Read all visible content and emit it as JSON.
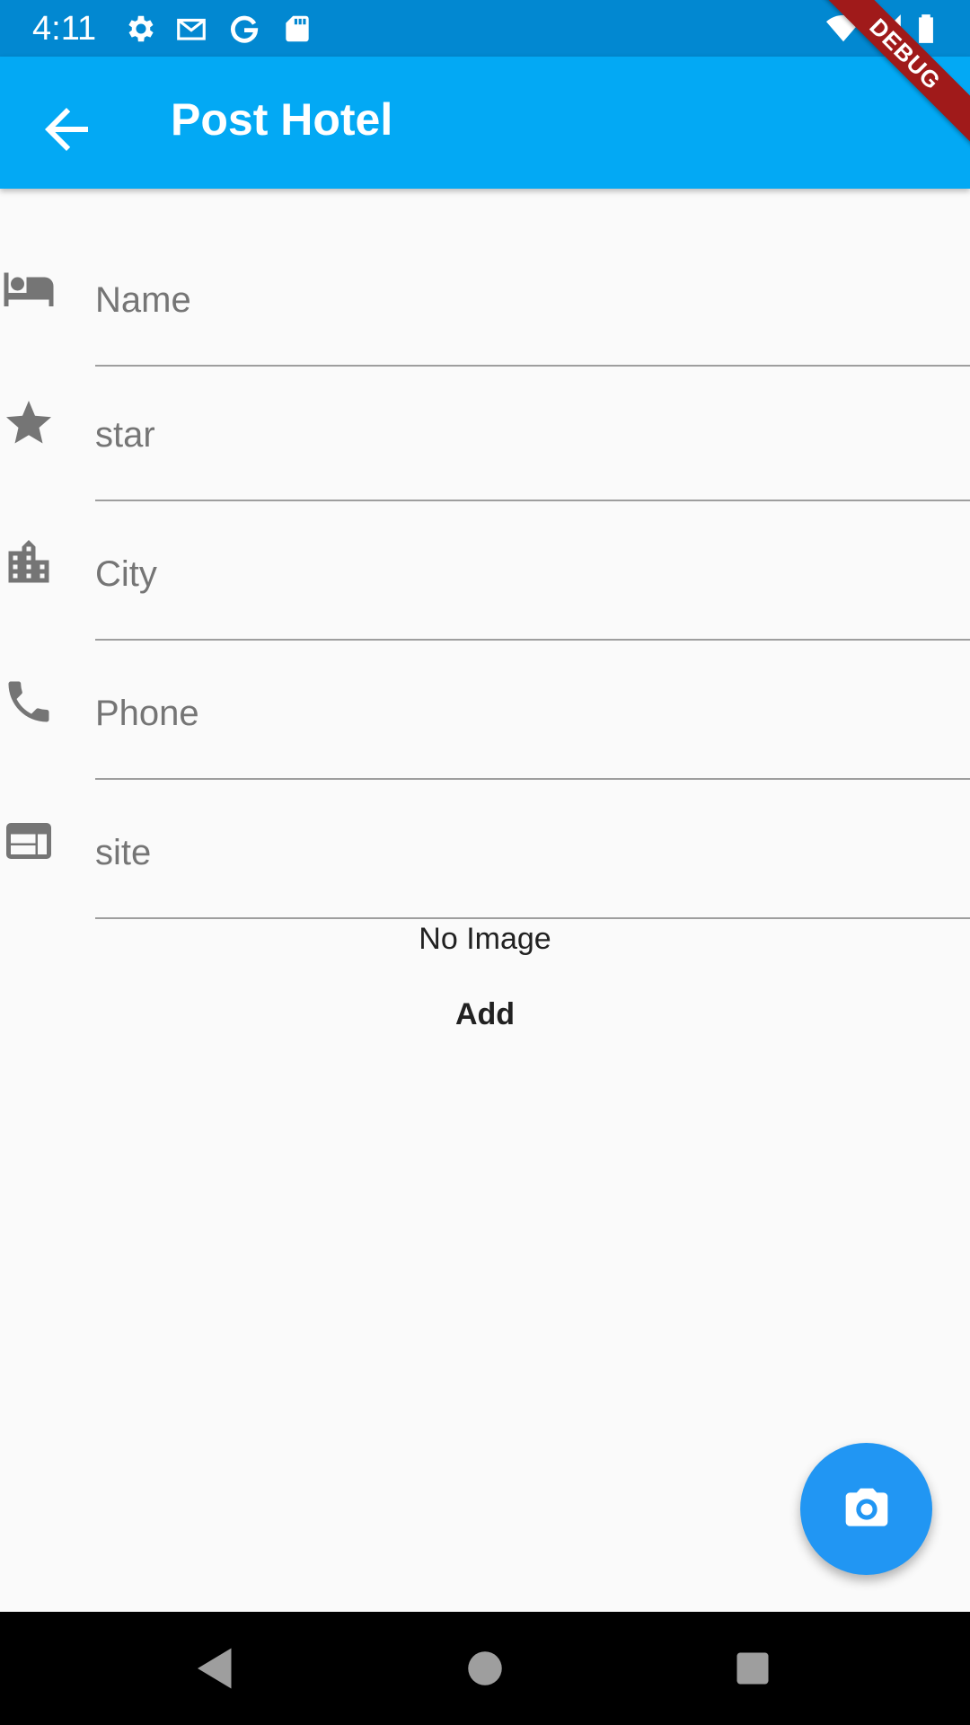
{
  "status_bar": {
    "time": "4:11",
    "icons": [
      "settings-icon",
      "gmail-icon",
      "google-icon",
      "sd-card-icon",
      "wifi-icon",
      "signal-icon",
      "battery-icon"
    ]
  },
  "app_bar": {
    "title": "Post Hotel",
    "back_icon": "arrow-back-icon",
    "color": "#03a9f4"
  },
  "debug_banner": "DEBUG",
  "form": {
    "fields": [
      {
        "icon": "hotel-bed-icon",
        "placeholder": "Name",
        "value": ""
      },
      {
        "icon": "star-icon",
        "placeholder": "star",
        "value": ""
      },
      {
        "icon": "city-icon",
        "placeholder": "City",
        "value": ""
      },
      {
        "icon": "phone-icon",
        "placeholder": "Phone",
        "value": ""
      },
      {
        "icon": "web-icon",
        "placeholder": "site",
        "value": ""
      }
    ],
    "image_status": "No Image",
    "add_label": "Add"
  },
  "fab": {
    "icon": "camera-icon",
    "color": "#2196f3"
  },
  "nav_bar": {
    "icons": [
      "back-triangle-icon",
      "home-circle-icon",
      "recents-square-icon"
    ]
  }
}
